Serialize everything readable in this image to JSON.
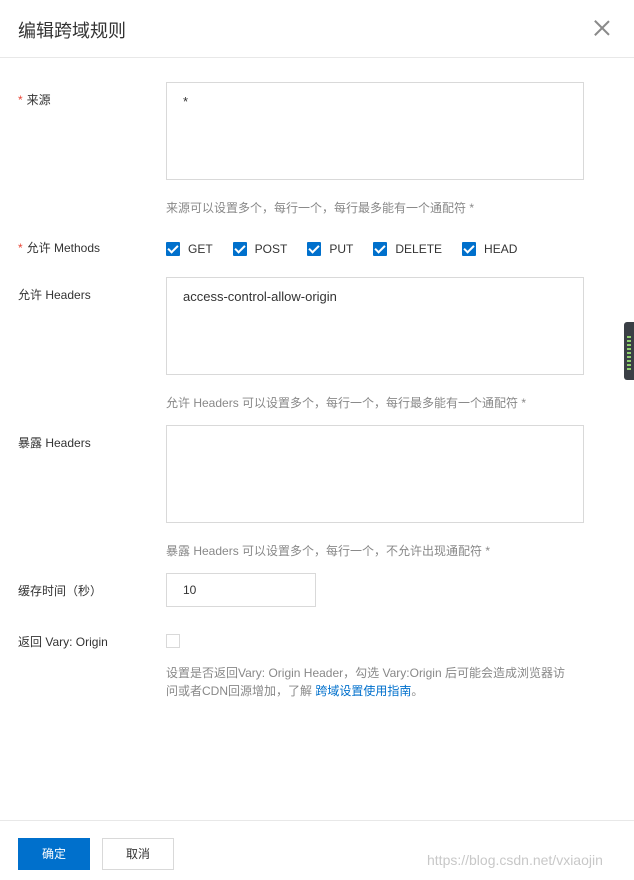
{
  "dialog": {
    "title": "编辑跨域规则"
  },
  "form": {
    "origin": {
      "required_mark": "*",
      "label": "来源",
      "value": "*",
      "help": "来源可以设置多个，每行一个，每行最多能有一个通配符 *"
    },
    "methods": {
      "required_mark": "*",
      "label": "允许 Methods",
      "options": [
        {
          "label": "GET",
          "checked": true
        },
        {
          "label": "POST",
          "checked": true
        },
        {
          "label": "PUT",
          "checked": true
        },
        {
          "label": "DELETE",
          "checked": true
        },
        {
          "label": "HEAD",
          "checked": true
        }
      ]
    },
    "allow_headers": {
      "label": "允许 Headers",
      "value": "access-control-allow-origin",
      "help": "允许 Headers 可以设置多个，每行一个，每行最多能有一个通配符 *"
    },
    "expose_headers": {
      "label": "暴露 Headers",
      "value": "",
      "help": "暴露 Headers 可以设置多个，每行一个，不允许出现通配符 *"
    },
    "cache_time": {
      "label": "缓存时间（秒）",
      "value": "10"
    },
    "vary_origin": {
      "label": "返回 Vary: Origin",
      "checked": false,
      "help_line1": "设置是否返回Vary: Origin Header，勾选 Vary:Origin 后可能会造成浏览器访",
      "help_line2_prefix": "问或者CDN回源增加，了解 ",
      "help_link": "跨域设置使用指南",
      "help_line2_suffix": "。"
    }
  },
  "footer": {
    "confirm_label": "确定",
    "cancel_label": "取消"
  },
  "watermark": "https://blog.csdn.net/vxiaojin",
  "colors": {
    "primary": "#0070cc",
    "required": "#e84738",
    "help_text": "#888888"
  }
}
